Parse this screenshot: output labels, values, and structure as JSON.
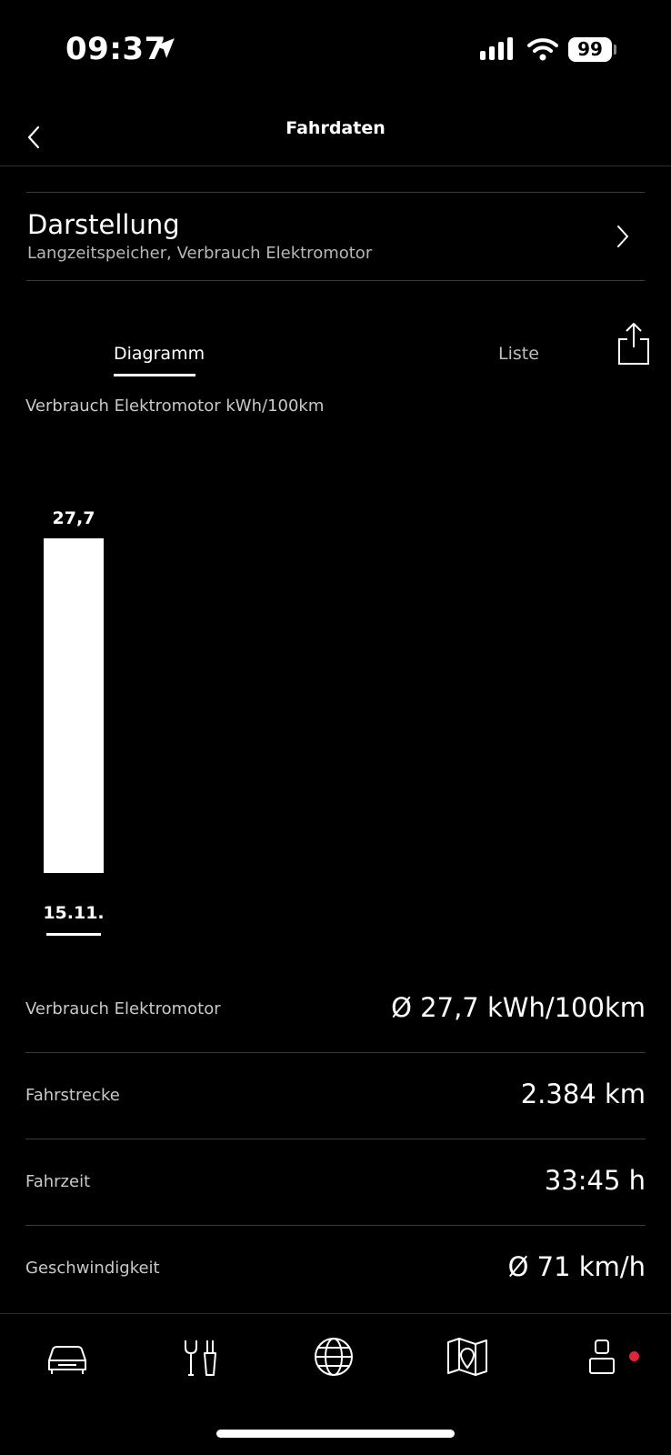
{
  "status_bar": {
    "time": "09:37",
    "battery": "99"
  },
  "header": {
    "title": "Fahrdaten"
  },
  "display_setting": {
    "title": "Darstellung",
    "subtitle": "Langzeitspeicher, Verbrauch Elektromotor"
  },
  "tabs": [
    {
      "label": "Diagramm",
      "active": true
    },
    {
      "label": "Liste",
      "active": false
    }
  ],
  "chart_label": "Verbrauch Elektromotor kWh/100km",
  "chart_data": {
    "type": "bar",
    "title": "Verbrauch Elektromotor kWh/100km",
    "categories": [
      "15.11."
    ],
    "values": [
      27.7
    ],
    "value_labels": [
      "27,7"
    ],
    "xlabel": "",
    "ylabel": "",
    "ylim": [
      0,
      27.7
    ],
    "grid": false,
    "bar_color": "#ffffff"
  },
  "stats": [
    {
      "label": "Verbrauch Elektromotor",
      "value": "Ø 27,7 kWh/100km"
    },
    {
      "label": "Fahrstrecke",
      "value": "2.384 km"
    },
    {
      "label": "Fahrzeit",
      "value": "33:45 h"
    },
    {
      "label": "Geschwindigkeit",
      "value": "Ø 71 km/h"
    }
  ],
  "tabbar": {
    "items": [
      "car-icon",
      "tools-icon",
      "globe-icon",
      "map-icon",
      "profile-icon"
    ],
    "notification_color": "#e0243a"
  }
}
